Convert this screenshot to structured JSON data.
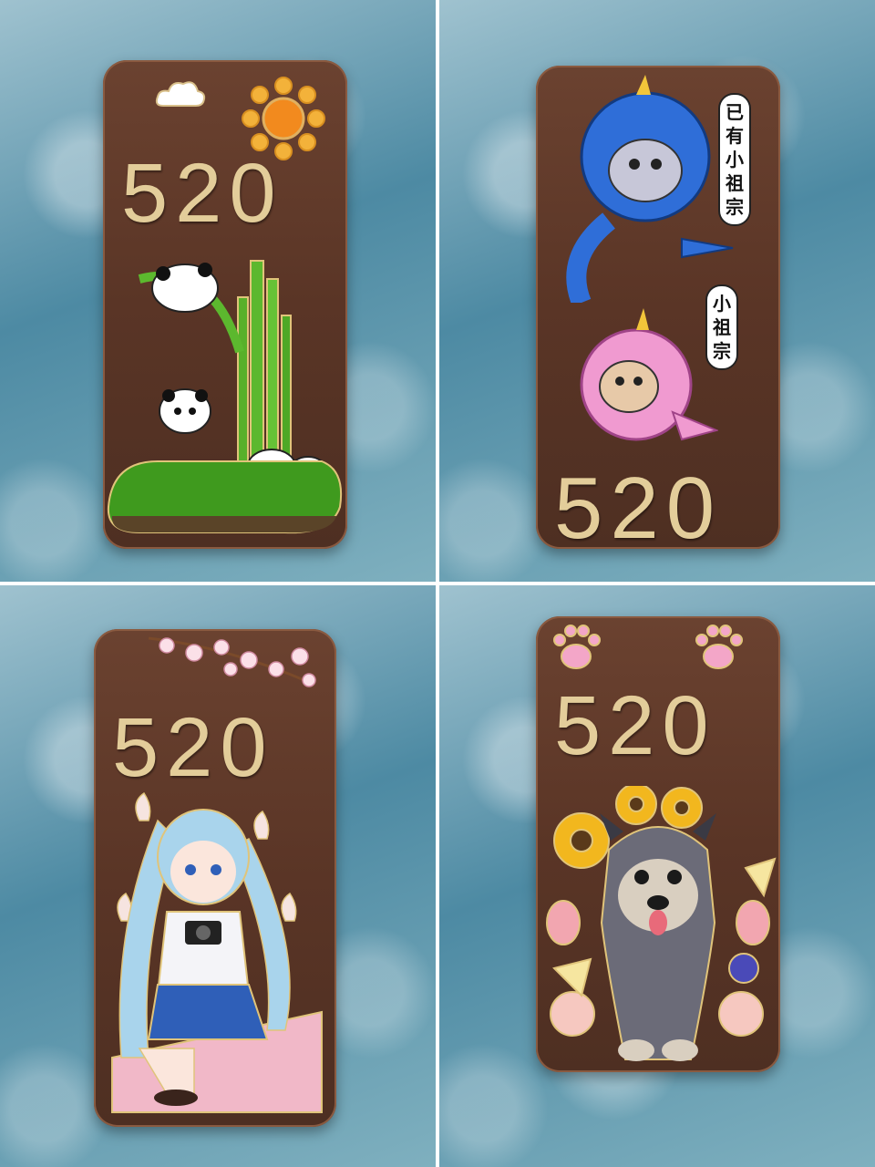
{
  "panels": [
    {
      "id": "panda",
      "number": "520"
    },
    {
      "id": "dinosaur-cats",
      "number": "520",
      "labels": [
        "已有小祖宗",
        "小祖宗"
      ]
    },
    {
      "id": "anime-girl",
      "number": "520"
    },
    {
      "id": "schnauzer",
      "number": "520"
    }
  ],
  "colors": {
    "wood": "#5a3526",
    "brass": "#e3cd9a",
    "glass": "#6fa3b6"
  }
}
